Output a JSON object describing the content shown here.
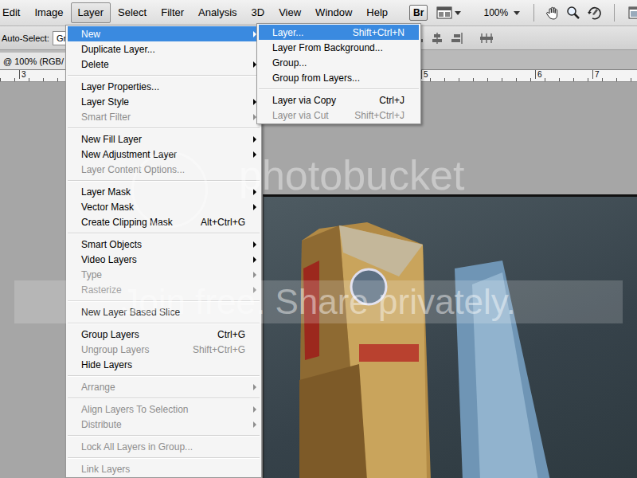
{
  "menubar": {
    "items": [
      {
        "label": "Edit",
        "selected": false
      },
      {
        "label": "Image",
        "selected": false
      },
      {
        "label": "Layer",
        "selected": true
      },
      {
        "label": "Select",
        "selected": false
      },
      {
        "label": "Filter",
        "selected": false
      },
      {
        "label": "Analysis",
        "selected": false
      },
      {
        "label": "3D",
        "selected": false
      },
      {
        "label": "View",
        "selected": false
      },
      {
        "label": "Window",
        "selected": false
      },
      {
        "label": "Help",
        "selected": false
      }
    ],
    "bridge": "Br",
    "zoom": "100%"
  },
  "options_bar": {
    "label": "Auto-Select:",
    "dropdown": "Gro"
  },
  "doc_tab": {
    "title": "@ 100% (RGB/"
  },
  "ruler": {
    "ticks": [
      "3",
      "5",
      "6",
      "7"
    ]
  },
  "layer_menu": {
    "items": [
      {
        "kind": "item",
        "label": "New",
        "shortcut": "",
        "submenu": true,
        "disabled": false,
        "selected": true
      },
      {
        "kind": "item",
        "label": "Duplicate Layer...",
        "shortcut": "",
        "submenu": false,
        "disabled": false,
        "selected": false
      },
      {
        "kind": "item",
        "label": "Delete",
        "shortcut": "",
        "submenu": true,
        "disabled": false,
        "selected": false
      },
      {
        "kind": "separator"
      },
      {
        "kind": "item",
        "label": "Layer Properties...",
        "shortcut": "",
        "submenu": false,
        "disabled": false,
        "selected": false
      },
      {
        "kind": "item",
        "label": "Layer Style",
        "shortcut": "",
        "submenu": true,
        "disabled": false,
        "selected": false
      },
      {
        "kind": "item",
        "label": "Smart Filter",
        "shortcut": "",
        "submenu": true,
        "disabled": true,
        "selected": false
      },
      {
        "kind": "separator"
      },
      {
        "kind": "item",
        "label": "New Fill Layer",
        "shortcut": "",
        "submenu": true,
        "disabled": false,
        "selected": false
      },
      {
        "kind": "item",
        "label": "New Adjustment Layer",
        "shortcut": "",
        "submenu": true,
        "disabled": false,
        "selected": false
      },
      {
        "kind": "item",
        "label": "Layer Content Options...",
        "shortcut": "",
        "submenu": false,
        "disabled": true,
        "selected": false
      },
      {
        "kind": "separator"
      },
      {
        "kind": "item",
        "label": "Layer Mask",
        "shortcut": "",
        "submenu": true,
        "disabled": false,
        "selected": false
      },
      {
        "kind": "item",
        "label": "Vector Mask",
        "shortcut": "",
        "submenu": true,
        "disabled": false,
        "selected": false
      },
      {
        "kind": "item",
        "label": "Create Clipping Mask",
        "shortcut": "Alt+Ctrl+G",
        "submenu": false,
        "disabled": false,
        "selected": false
      },
      {
        "kind": "separator"
      },
      {
        "kind": "item",
        "label": "Smart Objects",
        "shortcut": "",
        "submenu": true,
        "disabled": false,
        "selected": false
      },
      {
        "kind": "item",
        "label": "Video Layers",
        "shortcut": "",
        "submenu": true,
        "disabled": false,
        "selected": false
      },
      {
        "kind": "item",
        "label": "Type",
        "shortcut": "",
        "submenu": true,
        "disabled": true,
        "selected": false
      },
      {
        "kind": "item",
        "label": "Rasterize",
        "shortcut": "",
        "submenu": true,
        "disabled": true,
        "selected": false
      },
      {
        "kind": "separator"
      },
      {
        "kind": "item",
        "label": "New Layer Based Slice",
        "shortcut": "",
        "submenu": false,
        "disabled": false,
        "selected": false
      },
      {
        "kind": "separator"
      },
      {
        "kind": "item",
        "label": "Group Layers",
        "shortcut": "Ctrl+G",
        "submenu": false,
        "disabled": false,
        "selected": false
      },
      {
        "kind": "item",
        "label": "Ungroup Layers",
        "shortcut": "Shift+Ctrl+G",
        "submenu": false,
        "disabled": true,
        "selected": false
      },
      {
        "kind": "item",
        "label": "Hide Layers",
        "shortcut": "",
        "submenu": false,
        "disabled": false,
        "selected": false
      },
      {
        "kind": "separator"
      },
      {
        "kind": "item",
        "label": "Arrange",
        "shortcut": "",
        "submenu": true,
        "disabled": true,
        "selected": false
      },
      {
        "kind": "separator"
      },
      {
        "kind": "item",
        "label": "Align Layers To Selection",
        "shortcut": "",
        "submenu": true,
        "disabled": true,
        "selected": false
      },
      {
        "kind": "item",
        "label": "Distribute",
        "shortcut": "",
        "submenu": true,
        "disabled": true,
        "selected": false
      },
      {
        "kind": "separator"
      },
      {
        "kind": "item",
        "label": "Lock All Layers in Group...",
        "shortcut": "",
        "submenu": false,
        "disabled": true,
        "selected": false
      },
      {
        "kind": "separator"
      },
      {
        "kind": "item",
        "label": "Link Layers",
        "shortcut": "",
        "submenu": false,
        "disabled": true,
        "selected": false
      }
    ]
  },
  "new_submenu": {
    "items": [
      {
        "kind": "item",
        "label": "Layer...",
        "shortcut": "Shift+Ctrl+N",
        "submenu": false,
        "disabled": false,
        "selected": true
      },
      {
        "kind": "item",
        "label": "Layer From Background...",
        "shortcut": "",
        "submenu": false,
        "disabled": false,
        "selected": false
      },
      {
        "kind": "item",
        "label": "Group...",
        "shortcut": "",
        "submenu": false,
        "disabled": false,
        "selected": false
      },
      {
        "kind": "item",
        "label": "Group from Layers...",
        "shortcut": "",
        "submenu": false,
        "disabled": false,
        "selected": false
      },
      {
        "kind": "separator"
      },
      {
        "kind": "item",
        "label": "Layer via Copy",
        "shortcut": "Ctrl+J",
        "submenu": false,
        "disabled": false,
        "selected": false
      },
      {
        "kind": "item",
        "label": "Layer via Cut",
        "shortcut": "Shift+Ctrl+J",
        "submenu": false,
        "disabled": true,
        "selected": false
      }
    ]
  },
  "watermark": {
    "title": "photobucket",
    "tagline": "Join free. Share privately."
  }
}
